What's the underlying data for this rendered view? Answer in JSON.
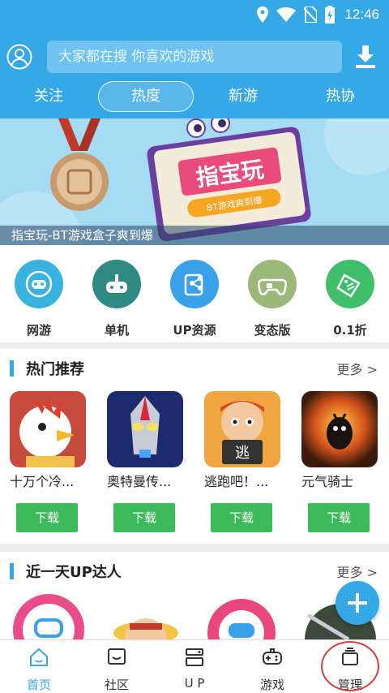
{
  "status_bar": {
    "time": "12:46"
  },
  "search": {
    "placeholder": "大家都在搜 你喜欢的游戏"
  },
  "tabs": [
    {
      "label": "关注"
    },
    {
      "label": "热度"
    },
    {
      "label": "新游"
    },
    {
      "label": "热协"
    }
  ],
  "banner": {
    "caption": "指宝玩-BT游戏盒子爽到爆",
    "sign_title": "指宝玩",
    "sign_sub": "BT游戏爽到爆"
  },
  "categories": [
    {
      "label": "网游",
      "icon": "gamepad-icon",
      "color": "#3bb3e0"
    },
    {
      "label": "单机",
      "icon": "joystick-icon",
      "color": "#2f8a86"
    },
    {
      "label": "UP资源",
      "icon": "share-icon",
      "color": "#3aa0e8"
    },
    {
      "label": "变态版",
      "icon": "bt-gamepad-icon",
      "color": "#9bb77a"
    },
    {
      "label": "0.1折",
      "icon": "discount-icon",
      "color": "#3fbf6a"
    }
  ],
  "hot": {
    "title": "热门推荐",
    "more": "更多 >",
    "games": [
      {
        "name": "十万个冷...",
        "button": "下载"
      },
      {
        "name": "奥特曼传...",
        "button": "下载"
      },
      {
        "name": "逃跑吧！...",
        "button": "下载"
      },
      {
        "name": "元气骑士",
        "button": "下载"
      }
    ]
  },
  "up": {
    "title": "近一天UP达人",
    "more": "更多 >"
  },
  "nav": [
    {
      "label": "首页"
    },
    {
      "label": "社区"
    },
    {
      "label": "U P"
    },
    {
      "label": "游戏"
    },
    {
      "label": "管理"
    }
  ],
  "colors": {
    "primary": "#35a8e6",
    "download_green": "#3dba5a",
    "highlight_ring": "#d93a3a"
  }
}
